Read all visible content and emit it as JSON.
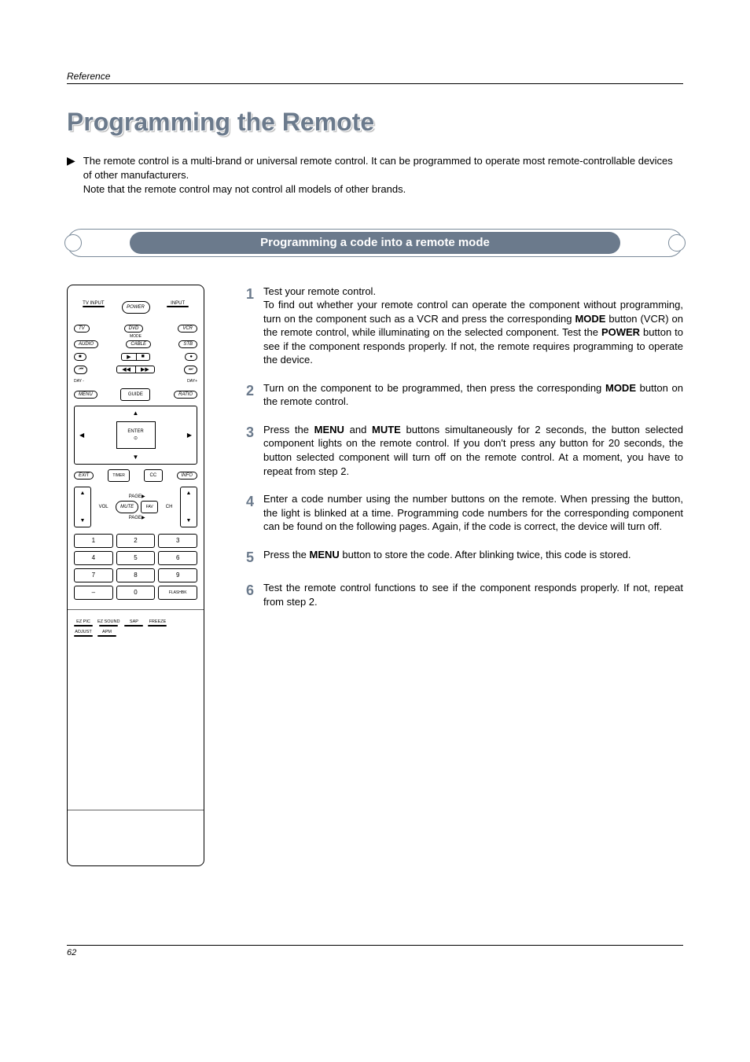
{
  "header": {
    "section": "Reference",
    "title": "Programming the Remote"
  },
  "intro": "The remote control is a multi-brand or universal remote control. It can be programmed to operate most remote-controllable devices of other manufacturers.\nNote that the remote control may not control all models of other brands.",
  "banner": "Programming a code into a remote mode",
  "remote": {
    "topLeft": "TV INPUT",
    "power": "POWER",
    "topRight": "INPUT",
    "modeRow1": [
      "TV",
      "DVD",
      "VCR"
    ],
    "modeLabel": "MODE",
    "modeRow2": [
      "AUDIO",
      "CABLE",
      "STB"
    ],
    "dayMinus": "DAY -",
    "dayPlus": "DAY+",
    "menu": "MENU",
    "guide": "GUIDE",
    "ratio": "RATIO",
    "enter": "ENTER",
    "exit": "EXIT",
    "timer": "TIMER",
    "cc": "CC",
    "info": "INFO",
    "vol": "VOL",
    "ch": "CH",
    "mute": "MUTE",
    "fav": "FAV",
    "page": "PAGE",
    "nums": [
      "1",
      "2",
      "3",
      "4",
      "5",
      "6",
      "7",
      "8",
      "9",
      "–",
      "0",
      "FLASHBK"
    ],
    "bottom": [
      "EZ PIC",
      "EZ SOUND",
      "SAP",
      "FREEZE",
      "ADJUST",
      "APM"
    ]
  },
  "steps": [
    {
      "n": "1",
      "text": "Test your remote control.\nTo find out whether your remote control can operate the component without programming, turn on the component such as a VCR and press the corresponding <b>MODE</b> button (VCR) on the remote control, while illuminating on the selected component. Test the <b>POWER</b> button to see if the component responds properly. If not, the remote requires programming to operate the device."
    },
    {
      "n": "2",
      "text": "Turn on the component to be programmed, then press the corresponding <b>MODE</b> button on the remote control."
    },
    {
      "n": "3",
      "text": "Press the <b>MENU</b> and <b>MUTE</b> buttons simultaneously for 2 seconds, the button selected component lights on the remote control. If you don't press any button for 20 seconds, the button selected component will turn off on the remote control. At a moment, you have to repeat from step 2."
    },
    {
      "n": "4",
      "text": "Enter a code number using the number buttons on the remote. When pressing the button, the light is blinked at a time. Programming code numbers for the corresponding component can be found on the following pages. Again, if the code is correct, the device will turn off."
    },
    {
      "n": "5",
      "text": "Press the <b>MENU</b> button to store the code. After blinking twice, this code is stored."
    },
    {
      "n": "6",
      "text": "Test the remote control functions to see if the component responds properly. If not, repeat from step 2."
    }
  ],
  "pageNumber": "62"
}
